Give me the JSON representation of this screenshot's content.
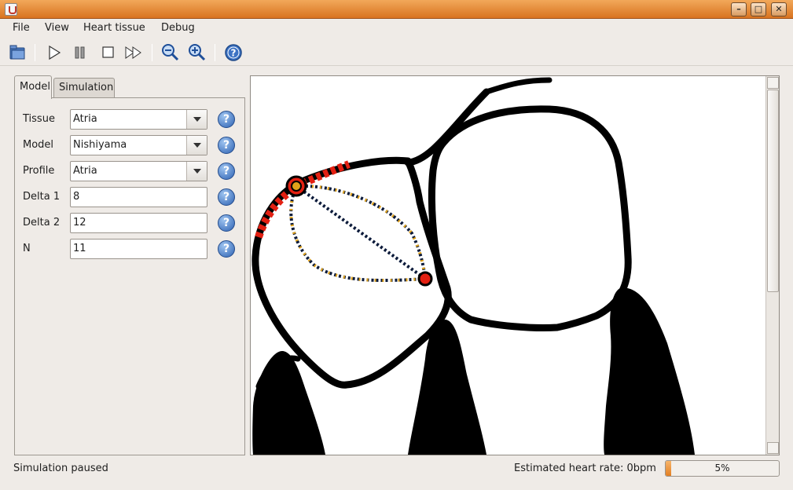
{
  "window": {
    "minimize": "–",
    "maximize": "□",
    "close": "✕"
  },
  "menu": [
    "File",
    "View",
    "Heart tissue",
    "Debug"
  ],
  "toolbar": [
    "open-icon",
    "play-icon",
    "pause-icon",
    "stop-icon",
    "fast-forward-icon",
    "zoom-out-icon",
    "zoom-in-icon",
    "help-icon"
  ],
  "tabs": {
    "model": "Model",
    "simulation": "Simulation"
  },
  "form": {
    "tissue": {
      "label": "Tissue",
      "value": "Atria"
    },
    "model": {
      "label": "Model",
      "value": "Nishiyama"
    },
    "profile": {
      "label": "Profile",
      "value": "Atria"
    },
    "delta1": {
      "label": "Delta 1",
      "value": "8"
    },
    "delta2": {
      "label": "Delta 2",
      "value": "12"
    },
    "n": {
      "label": "N",
      "value": "11"
    },
    "help_glyph": "?"
  },
  "status": {
    "text": "Simulation paused",
    "heart_rate_label": "Estimated heart rate:  0bpm",
    "progress_text": "5%",
    "progress_fraction": 0.05
  },
  "colors": {
    "title_bar": "#e08a3a",
    "progress": "#e27f23",
    "excited_cell": "#e32012",
    "cell_dot": "#e0a21a"
  }
}
